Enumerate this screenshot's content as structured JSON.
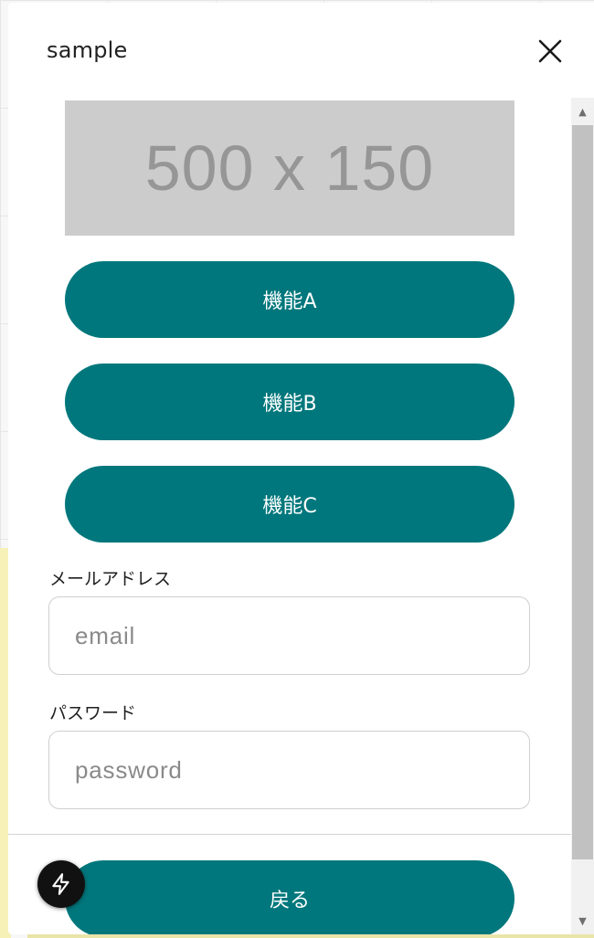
{
  "modal": {
    "title": "sample",
    "close_icon": "close-icon"
  },
  "banner": {
    "text": "500 x 150"
  },
  "buttons": [
    {
      "label": "機能A"
    },
    {
      "label": "機能B"
    },
    {
      "label": "機能C"
    }
  ],
  "form": {
    "email": {
      "label": "メールアドレス",
      "placeholder": "email",
      "value": ""
    },
    "password": {
      "label": "パスワード",
      "placeholder": "password",
      "value": ""
    }
  },
  "footer": {
    "back_label": "戻る"
  },
  "fab": {
    "icon": "lightning-bolt-icon"
  },
  "scrollbar": {
    "up_icon": "scroll-up-arrow-icon",
    "down_icon": "scroll-down-arrow-icon"
  },
  "colors": {
    "accent": "#00777c",
    "placeholder_bg": "#cccccc",
    "scrollbar_thumb": "#c1c1c1",
    "fab_bg": "#111111",
    "background_yellow": "#f6f1b7"
  }
}
